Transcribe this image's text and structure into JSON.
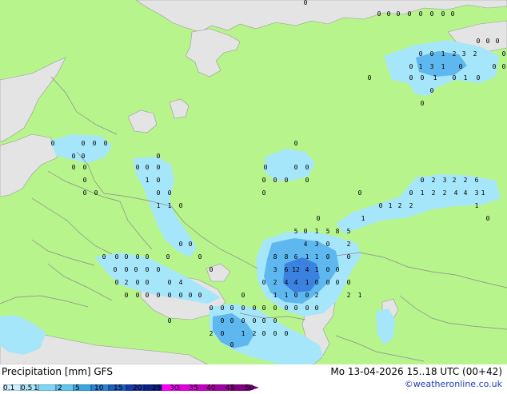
{
  "header": {
    "title": "Precipitation [mm]  GFS",
    "datetime": "Mo 13-04-2026 15..18 UTC (00+42)",
    "credit": "©weatheronline.co.uk"
  },
  "legend": {
    "labels": [
      "0.1",
      "0.5",
      "1",
      "2",
      "5",
      "10",
      "15",
      "20",
      "25",
      "30",
      "35",
      "40",
      "45",
      "50"
    ],
    "colors": [
      "#c8f0ff",
      "#a6e6fa",
      "#7fd6f4",
      "#5ec6ef",
      "#3aa6e0",
      "#2b82d4",
      "#1f5cc0",
      "#1737a5",
      "#0c1f8a",
      "#ff00ff",
      "#e000e0",
      "#c000c0",
      "#a000a0",
      "#800080"
    ]
  },
  "map": {
    "land_color": "#b7f48c",
    "water_color": "#e4e4e4",
    "rain_light_color": "#a6e6fa",
    "rain_mid_color": "#5eb8ef",
    "rain_heavy_color": "#3b82e0"
  },
  "values": [
    {
      "t": "0"
    },
    {
      "t": "0"
    },
    {
      "t": "0"
    },
    {
      "t": "0"
    },
    {
      "t": "0"
    },
    {
      "t": "0"
    },
    {
      "t": "0"
    },
    {
      "t": "0"
    },
    {
      "t": "0"
    },
    {
      "t": "0"
    },
    {
      "t": "0"
    },
    {
      "t": "0"
    },
    {
      "t": "0"
    },
    {
      "t": "0"
    },
    {
      "t": "1"
    },
    {
      "t": "2"
    },
    {
      "t": "3"
    },
    {
      "t": "2"
    },
    {
      "t": "0"
    },
    {
      "t": "0"
    },
    {
      "t": "1"
    },
    {
      "t": "3"
    },
    {
      "t": "1"
    },
    {
      "t": "0"
    },
    {
      "t": "0"
    },
    {
      "t": "0"
    },
    {
      "t": "0"
    },
    {
      "t": "0"
    },
    {
      "t": "0"
    },
    {
      "t": "1"
    },
    {
      "t": "0"
    },
    {
      "t": "1"
    },
    {
      "t": "0"
    },
    {
      "t": "0"
    },
    {
      "t": "0"
    },
    {
      "t": "0"
    },
    {
      "t": "0"
    },
    {
      "t": "0"
    },
    {
      "t": "0"
    },
    {
      "t": "0"
    },
    {
      "t": "0"
    },
    {
      "t": "0"
    },
    {
      "t": "0"
    },
    {
      "t": "0"
    },
    {
      "t": "0"
    },
    {
      "t": "0"
    },
    {
      "t": "0"
    },
    {
      "t": "0"
    },
    {
      "t": "0"
    },
    {
      "t": "0"
    },
    {
      "t": "0"
    },
    {
      "t": "0"
    },
    {
      "t": "1"
    },
    {
      "t": "0"
    },
    {
      "t": "0"
    },
    {
      "t": "0"
    },
    {
      "t": "0"
    },
    {
      "t": "0"
    },
    {
      "t": "0"
    },
    {
      "t": "0"
    },
    {
      "t": "0"
    },
    {
      "t": "0"
    },
    {
      "t": "0"
    },
    {
      "t": "0"
    },
    {
      "t": "0"
    },
    {
      "t": "2"
    },
    {
      "t": "3"
    },
    {
      "t": "2"
    },
    {
      "t": "2"
    },
    {
      "t": "6"
    },
    {
      "t": "0"
    },
    {
      "t": "1"
    },
    {
      "t": "2"
    },
    {
      "t": "2"
    },
    {
      "t": "4"
    },
    {
      "t": "4"
    },
    {
      "t": "3"
    },
    {
      "t": "1"
    },
    {
      "t": "1"
    },
    {
      "t": "1"
    },
    {
      "t": "0"
    },
    {
      "t": "0"
    },
    {
      "t": "1"
    },
    {
      "t": "2"
    },
    {
      "t": "2"
    },
    {
      "t": "1"
    },
    {
      "t": "0"
    },
    {
      "t": "1"
    },
    {
      "t": "0"
    },
    {
      "t": "0"
    },
    {
      "t": "0"
    },
    {
      "t": "0"
    },
    {
      "t": "0"
    },
    {
      "t": "0"
    },
    {
      "t": "0"
    },
    {
      "t": "0"
    },
    {
      "t": "0"
    },
    {
      "t": "0"
    },
    {
      "t": "0"
    },
    {
      "t": "0"
    },
    {
      "t": "0"
    },
    {
      "t": "0"
    },
    {
      "t": "0"
    },
    {
      "t": "0"
    },
    {
      "t": "0"
    },
    {
      "t": "2"
    },
    {
      "t": "0"
    },
    {
      "t": "0"
    },
    {
      "t": "0"
    },
    {
      "t": "4"
    },
    {
      "t": "5"
    },
    {
      "t": "0"
    },
    {
      "t": "1"
    },
    {
      "t": "5"
    },
    {
      "t": "8"
    },
    {
      "t": "5"
    },
    {
      "t": "4"
    },
    {
      "t": "3"
    },
    {
      "t": "0"
    },
    {
      "t": "2"
    },
    {
      "t": "8"
    },
    {
      "t": "8"
    },
    {
      "t": "6"
    },
    {
      "t": "1"
    },
    {
      "t": "1"
    },
    {
      "t": "0"
    },
    {
      "t": "0"
    },
    {
      "t": "3"
    },
    {
      "t": "6"
    },
    {
      "t": "12"
    },
    {
      "t": "4"
    },
    {
      "t": "1"
    },
    {
      "t": "0"
    },
    {
      "t": "0"
    },
    {
      "t": "0"
    },
    {
      "t": "2"
    },
    {
      "t": "4"
    },
    {
      "t": "4"
    },
    {
      "t": "1"
    },
    {
      "t": "0"
    },
    {
      "t": "0"
    },
    {
      "t": "0"
    },
    {
      "t": "0"
    },
    {
      "t": "1"
    },
    {
      "t": "1"
    },
    {
      "t": "0"
    },
    {
      "t": "0"
    },
    {
      "t": "2"
    },
    {
      "t": "2"
    },
    {
      "t": "1"
    },
    {
      "t": "0"
    },
    {
      "t": "0"
    },
    {
      "t": "0"
    },
    {
      "t": "0"
    },
    {
      "t": "0"
    },
    {
      "t": "0"
    },
    {
      "t": "0"
    },
    {
      "t": "0"
    },
    {
      "t": "0"
    },
    {
      "t": "0"
    },
    {
      "t": "0"
    },
    {
      "t": "0"
    },
    {
      "t": "0"
    },
    {
      "t": "0"
    },
    {
      "t": "0"
    },
    {
      "t": "0"
    },
    {
      "t": "0"
    },
    {
      "t": "0"
    },
    {
      "t": "0"
    },
    {
      "t": "0"
    },
    {
      "t": "0"
    },
    {
      "t": "0"
    },
    {
      "t": "0"
    },
    {
      "t": "0"
    },
    {
      "t": "0"
    },
    {
      "t": "0"
    },
    {
      "t": "0"
    },
    {
      "t": "2"
    },
    {
      "t": "0"
    },
    {
      "t": "1"
    },
    {
      "t": "2"
    },
    {
      "t": "0"
    },
    {
      "t": "0"
    },
    {
      "t": "0"
    },
    {
      "t": "0"
    }
  ]
}
